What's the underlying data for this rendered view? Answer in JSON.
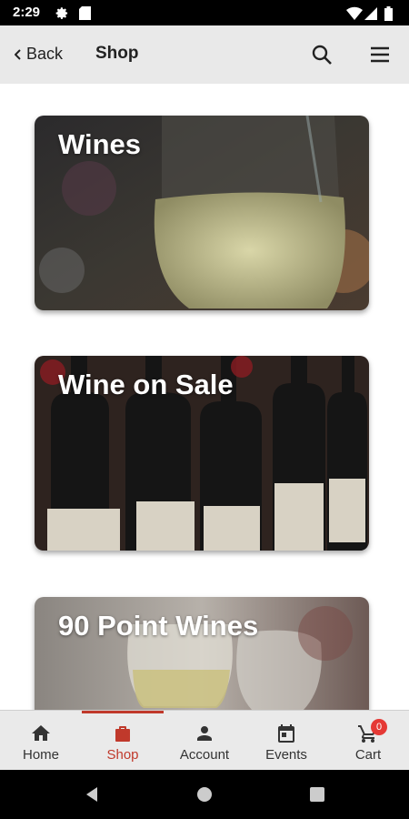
{
  "status_bar": {
    "time": "2:29"
  },
  "app_bar": {
    "back_label": "Back",
    "title": "Shop"
  },
  "cards": [
    {
      "title": "Wines"
    },
    {
      "title": "Wine on Sale"
    },
    {
      "title": "90 Point Wines"
    }
  ],
  "bottom_nav": {
    "items": [
      {
        "label": "Home",
        "icon": "home-icon"
      },
      {
        "label": "Shop",
        "icon": "shopping-bag-icon",
        "active": true
      },
      {
        "label": "Account",
        "icon": "person-icon"
      },
      {
        "label": "Events",
        "icon": "calendar-icon"
      },
      {
        "label": "Cart",
        "icon": "cart-icon"
      }
    ],
    "cart_badge": "0"
  },
  "colors": {
    "accent": "#c0392b",
    "app_bar_bg": "#e9e9e9",
    "badge": "#e53935"
  }
}
